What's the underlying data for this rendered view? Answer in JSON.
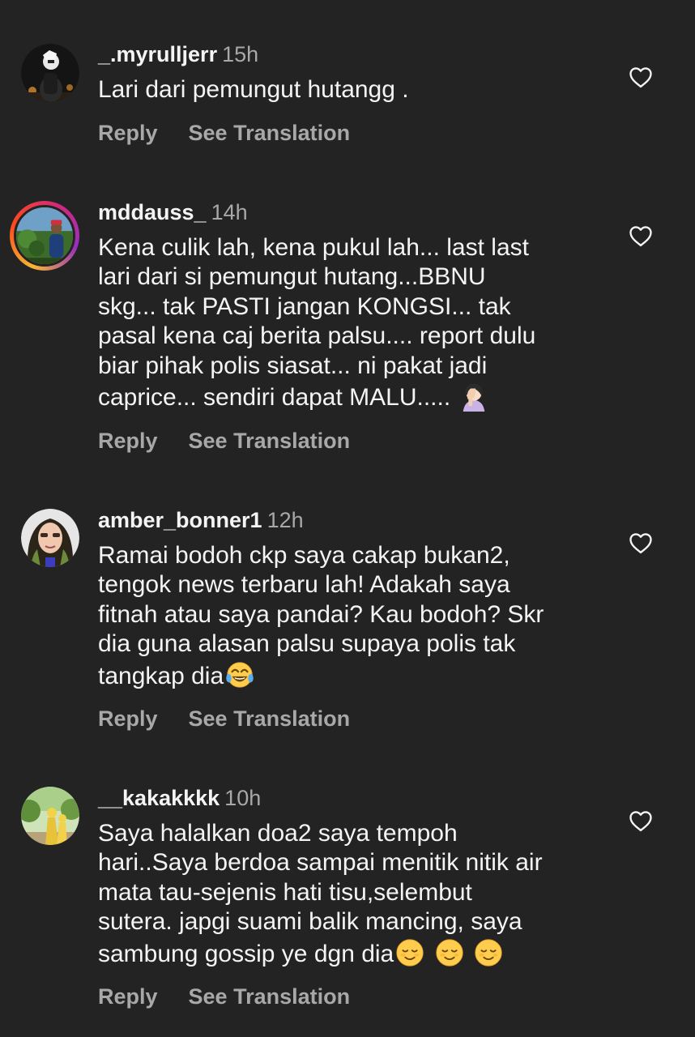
{
  "comments": [
    {
      "username": "_.myrulljerr",
      "time": "15h",
      "text": "Lari dari pemungut hutangg .",
      "reply_label": "Reply",
      "translate_label": "See Translation"
    },
    {
      "username": "mddauss_",
      "time": "14h",
      "text_lines": [
        "Kena culik lah, kena pukul lah... last last",
        "lari dari si pemungut hutang...BBNU",
        "skg... tak PASTI jangan KONGSI... tak",
        "pasal kena caj berita palsu.... report dulu",
        "biar pihak polis siasat... ni pakat jadi",
        "caprice... sendiri dapat MALU..... "
      ],
      "emoji": "face-palm-woman-emoji",
      "reply_label": "Reply",
      "translate_label": "See Translation"
    },
    {
      "username": "amber_bonner1",
      "time": "12h",
      "text_lines": [
        "Ramai bodoh ckp saya cakap bukan2,",
        "tengok news terbaru lah! Adakah saya",
        "fitnah atau saya pandai? Kau bodoh? Skr",
        "dia guna alasan palsu supaya polis tak",
        "tangkap dia"
      ],
      "emoji": "tears-of-joy-emoji",
      "reply_label": "Reply",
      "translate_label": "See Translation"
    },
    {
      "username": "__kakakkkk",
      "time": "10h",
      "text_lines": [
        "Saya halalkan doa2 saya tempoh",
        "hari..Saya berdoa sampai menitik nitik air",
        "mata tau-sejenis hati tisu,selembut",
        "sutera. japgi suami balik mancing, saya",
        "sambung gossip ye dgn dia"
      ],
      "emoji": "relieved-face-emoji",
      "reply_label": "Reply",
      "translate_label": "See Translation"
    }
  ],
  "colors": {
    "background": "#232323",
    "text": "#f4f4f4",
    "muted": "#a8a8a8"
  }
}
